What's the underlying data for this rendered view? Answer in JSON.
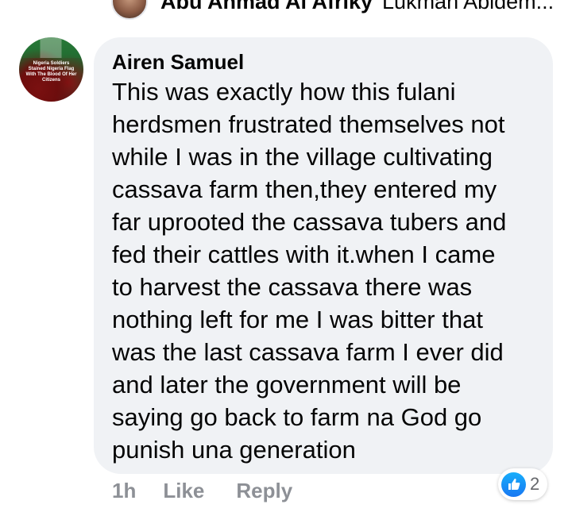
{
  "top_reply": {
    "author": "Abu Ahmad Al Afriky",
    "text": "Lukman Abidem..."
  },
  "comment": {
    "author": "Airen Samuel",
    "body_lines": [
      "This was exactly how this fulani",
      "herdsmen frustrated themselves not",
      "while I was in the village cultivating",
      "cassava farm then,they entered my",
      "far uprooted the cassava tubers and",
      "fed their cattles with it.when I came",
      "to harvest the cassava there was",
      "nothing left for me I was bitter that",
      "was the last cassava farm I ever did",
      "and later the government will be",
      "saying go back to farm na God go",
      "punish una generation"
    ],
    "time": "1h",
    "like_label": "Like",
    "reply_label": "Reply",
    "reaction_count": "2",
    "reaction_icon": "like-thumb-icon"
  },
  "colors": {
    "bubble": "#f0f2f5",
    "meta_text": "#8d9096",
    "like_blue": "#1877f2"
  }
}
